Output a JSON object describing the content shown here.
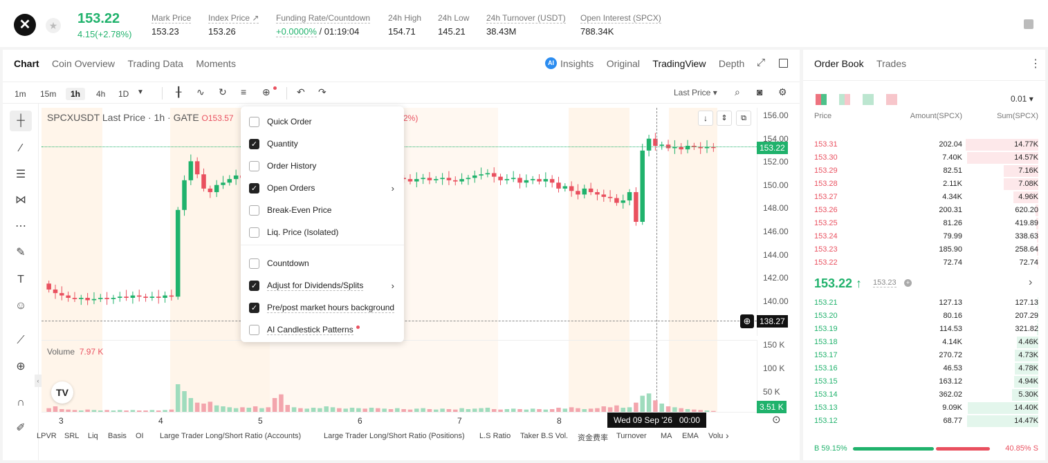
{
  "header": {
    "last_price": "153.22",
    "change": "4.15(+2.78%)",
    "stats": [
      {
        "label": "Mark Price",
        "value": "153.23"
      },
      {
        "label": "Index Price ↗",
        "value": "153.26"
      },
      {
        "label": "Funding Rate/Countdown",
        "value_green": "+0.0000%",
        "value": " / 01:19:04"
      },
      {
        "label": "24h High",
        "value": "154.71"
      },
      {
        "label": "24h Low",
        "value": "145.21"
      },
      {
        "label": "24h Turnover (USDT)",
        "value": "38.43M"
      },
      {
        "label": "Open Interest (SPCX)",
        "value": "788.34K"
      }
    ]
  },
  "chart_tabs": [
    "Chart",
    "Coin Overview",
    "Trading Data",
    "Moments"
  ],
  "view_tabs": {
    "insights": "Insights",
    "original": "Original",
    "tradingview": "TradingView",
    "depth": "Depth"
  },
  "timeframes": [
    "1m",
    "15m",
    "1h",
    "4h",
    "1D"
  ],
  "price_type": "Last Price ▾",
  "legend": {
    "symbol": "SPCXUSDT Last Price · 1h · GATE",
    "o": "O153.57",
    "pct": "2%)"
  },
  "y_ticks": [
    "156.00",
    "154.00",
    "152.00",
    "150.00",
    "148.00",
    "146.00",
    "144.00",
    "142.00",
    "140.00"
  ],
  "y_current": "153.22",
  "y_cross": "138.27",
  "vol_ticks": [
    "150 K",
    "100 K",
    "50 K"
  ],
  "vol_label": "Volume",
  "vol_value": "7.97 K",
  "vol_current": "3.51 K",
  "x_ticks": [
    "3",
    "4",
    "5",
    "6",
    "7",
    "8"
  ],
  "crosshair_time": "Wed 09 Sep '26   00:00",
  "menu": [
    {
      "label": "Quick Order",
      "checked": false
    },
    {
      "label": "Quantity",
      "checked": true
    },
    {
      "label": "Order History",
      "checked": false
    },
    {
      "label": "Open Orders",
      "checked": true,
      "sub": true
    },
    {
      "label": "Break-Even Price",
      "checked": false
    },
    {
      "label": "Liq. Price (Isolated)",
      "checked": false
    },
    {
      "label": "Countdown",
      "checked": false
    },
    {
      "label": "Adjust for Dividends/Splits",
      "checked": true,
      "sub": true
    },
    {
      "label": "Pre/post market hours background",
      "checked": true
    },
    {
      "label": "AI Candlestick Patterns",
      "checked": false
    }
  ],
  "indicators": [
    "LPVR",
    "SRL",
    "Liq",
    "Basis",
    "OI",
    "Large Trader Long/Short Ratio (Accounts)",
    "Large Trader Long/Short Ratio (Positions)",
    "L.S Ratio",
    "Taker B.S Vol.",
    "资金费率",
    "Turnover",
    "MA",
    "EMA",
    "Volu"
  ],
  "orderbook": {
    "tabs": [
      "Order Book",
      "Trades"
    ],
    "precision": "0.01 ▾",
    "cols": [
      "Price",
      "Amount(SPCX)",
      "Sum(SPCX)"
    ],
    "asks": [
      [
        "153.31",
        "202.04",
        "14.77K",
        1.0
      ],
      [
        "153.30",
        "7.40K",
        "14.57K",
        0.98
      ],
      [
        "153.29",
        "82.51",
        "7.16K",
        0.48
      ],
      [
        "153.28",
        "2.11K",
        "7.08K",
        0.48
      ],
      [
        "153.27",
        "4.34K",
        "4.96K",
        0.34
      ],
      [
        "153.26",
        "200.31",
        "620.20",
        0.04
      ],
      [
        "153.25",
        "81.26",
        "419.89",
        0.03
      ],
      [
        "153.24",
        "79.99",
        "338.63",
        0.02
      ],
      [
        "153.23",
        "185.90",
        "258.64",
        0.02
      ],
      [
        "153.22",
        "72.74",
        "72.74",
        0.01
      ]
    ],
    "mid": "153.22 ↑",
    "mid_mark": "153.23",
    "bids": [
      [
        "153.21",
        "127.13",
        "127.13",
        0.01
      ],
      [
        "153.20",
        "80.16",
        "207.29",
        0.01
      ],
      [
        "153.19",
        "114.53",
        "321.82",
        0.02
      ],
      [
        "153.18",
        "4.14K",
        "4.46K",
        0.3
      ],
      [
        "153.17",
        "270.72",
        "4.73K",
        0.32
      ],
      [
        "153.16",
        "46.53",
        "4.78K",
        0.32
      ],
      [
        "153.15",
        "163.12",
        "4.94K",
        0.33
      ],
      [
        "153.14",
        "362.02",
        "5.30K",
        0.36
      ],
      [
        "153.13",
        "9.09K",
        "14.40K",
        0.97
      ],
      [
        "153.12",
        "68.77",
        "14.47K",
        0.98
      ]
    ],
    "buy_pct": "59.15%",
    "sell_pct": "40.85%",
    "buy_label": "B",
    "sell_label": "S"
  },
  "chart_data": {
    "type": "candlestick",
    "y_range": [
      138,
      156
    ],
    "closes": [
      141.3,
      141.0,
      140.8,
      140.6,
      140.5,
      140.6,
      140.4,
      140.5,
      140.6,
      140.5,
      140.6,
      140.7,
      140.6,
      140.8,
      140.7,
      140.6,
      140.7,
      140.6,
      140.8,
      140.7,
      148.0,
      150.5,
      152.1,
      151.0,
      149.8,
      149.5,
      150.1,
      150.3,
      150.6,
      150.9,
      150.7,
      150.9,
      150.7,
      150.8,
      150.5,
      149.5,
      148.7,
      148.5,
      149.0,
      148.6,
      148.9,
      149.3,
      149.6,
      150.1,
      150.3,
      150.0,
      150.3,
      150.6,
      150.8,
      150.7,
      150.9,
      150.6,
      150.8,
      150.5,
      150.7,
      150.6,
      150.4,
      150.6,
      150.7,
      150.5,
      150.6,
      150.7,
      150.5,
      150.4,
      150.6,
      150.7,
      150.9,
      151.0,
      151.1,
      150.8,
      150.5,
      150.6,
      150.7,
      150.3,
      150.5,
      150.6,
      150.4,
      150.6,
      150.3,
      149.8,
      150.0,
      149.6,
      149.3,
      149.8,
      149.5,
      149.3,
      149.1,
      149.0,
      148.6,
      148.8,
      149.5,
      147.0,
      153.0,
      154.0,
      153.4,
      153.5,
      153.2,
      153.3,
      153.1,
      153.4,
      153.3,
      153.2,
      153.3,
      153.22
    ],
    "volume_range": [
      0,
      150000
    ],
    "last_volume": 3510,
    "x_labels": [
      "3",
      "4",
      "5",
      "6",
      "7",
      "8"
    ]
  }
}
